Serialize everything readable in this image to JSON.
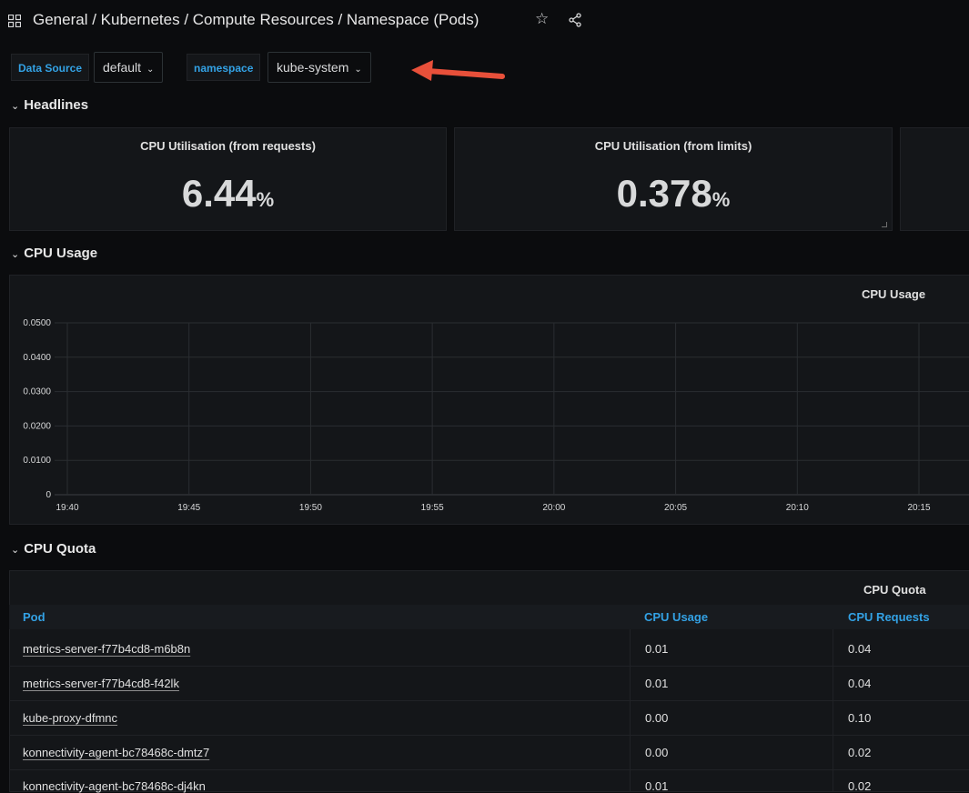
{
  "header": {
    "breadcrumb": "General / Kubernetes / Compute Resources / Namespace (Pods)",
    "icons": [
      "grid-icon",
      "star-icon",
      "share-icon"
    ]
  },
  "variables": {
    "datasource_label": "Data Source",
    "datasource_value": "default",
    "namespace_label": "namespace",
    "namespace_value": "kube-system"
  },
  "rows": {
    "headlines": "Headlines",
    "cpu_usage": "CPU Usage",
    "cpu_quota": "CPU Quota"
  },
  "stats": [
    {
      "title": "CPU Utilisation (from requests)",
      "value": "6.44",
      "unit": "%"
    },
    {
      "title": "CPU Utilisation (from limits)",
      "value": "0.378",
      "unit": "%"
    }
  ],
  "chart_data": {
    "type": "line",
    "title": "CPU Usage",
    "x_ticks": [
      "19:40",
      "19:45",
      "19:50",
      "19:55",
      "20:00",
      "20:05",
      "20:10",
      "20:15"
    ],
    "y_ticks": [
      "0",
      "0.0100",
      "0.0200",
      "0.0300",
      "0.0400",
      "0.0500"
    ],
    "ylim": [
      0,
      0.05
    ],
    "grid": true,
    "series": []
  },
  "quota_table": {
    "title": "CPU Quota",
    "columns": [
      "Pod",
      "CPU Usage",
      "CPU Requests"
    ],
    "rows": [
      [
        "metrics-server-f77b4cd8-m6b8n",
        "0.01",
        "0.04"
      ],
      [
        "metrics-server-f77b4cd8-f42lk",
        "0.01",
        "0.04"
      ],
      [
        "kube-proxy-dfmnc",
        "0.00",
        "0.10"
      ],
      [
        "konnectivity-agent-bc78468c-dmtz7",
        "0.00",
        "0.02"
      ],
      [
        "konnectivity-agent-bc78468c-dj4kn",
        "0.01",
        "0.02"
      ]
    ]
  },
  "colors": {
    "accent_link": "#33a2e5",
    "annotation_arrow": "#e8503a",
    "background": "#0b0c0e"
  }
}
